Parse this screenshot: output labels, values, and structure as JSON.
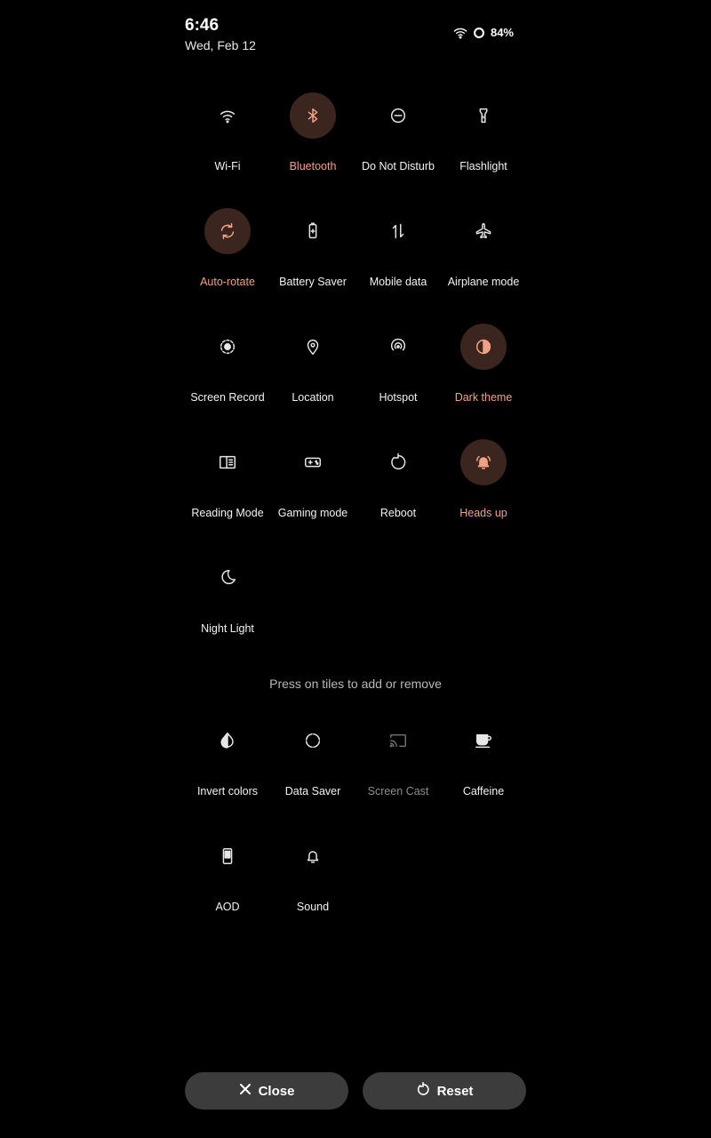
{
  "status_bar": {
    "time": "6:46",
    "date": "Wed, Feb 12",
    "battery": "84%"
  },
  "active_tiles": [
    {
      "label": "Wi-Fi",
      "icon": "wifi-icon",
      "active": false
    },
    {
      "label": "Bluetooth",
      "icon": "bluetooth-icon",
      "active": true
    },
    {
      "label": "Do Not Disturb",
      "icon": "do-not-disturb-icon",
      "active": false
    },
    {
      "label": "Flashlight",
      "icon": "flashlight-icon",
      "active": false
    },
    {
      "label": "Auto-rotate",
      "icon": "auto-rotate-icon",
      "active": true
    },
    {
      "label": "Battery Saver",
      "icon": "battery-saver-icon",
      "active": false
    },
    {
      "label": "Mobile data",
      "icon": "mobile-data-icon",
      "active": false
    },
    {
      "label": "Airplane mode",
      "icon": "airplane-icon",
      "active": false
    },
    {
      "label": "Screen Record",
      "icon": "screen-record-icon",
      "active": false
    },
    {
      "label": "Location",
      "icon": "location-icon",
      "active": false
    },
    {
      "label": "Hotspot",
      "icon": "hotspot-icon",
      "active": false
    },
    {
      "label": "Dark theme",
      "icon": "dark-theme-icon",
      "active": true
    },
    {
      "label": "Reading Mode",
      "icon": "reading-mode-icon",
      "active": false
    },
    {
      "label": "Gaming mode",
      "icon": "gaming-mode-icon",
      "active": false
    },
    {
      "label": "Reboot",
      "icon": "reboot-icon",
      "active": false
    },
    {
      "label": "Heads up",
      "icon": "heads-up-icon",
      "active": true
    },
    {
      "label": "Night Light",
      "icon": "night-light-icon",
      "active": false
    }
  ],
  "hint": "Press on tiles to add or remove",
  "available_tiles": [
    {
      "label": "Invert colors",
      "icon": "invert-colors-icon",
      "dim": false
    },
    {
      "label": "Data Saver",
      "icon": "data-saver-icon",
      "dim": false
    },
    {
      "label": "Screen Cast",
      "icon": "screen-cast-icon",
      "dim": true
    },
    {
      "label": "Caffeine",
      "icon": "caffeine-icon",
      "dim": false
    },
    {
      "label": "AOD",
      "icon": "aod-icon",
      "dim": false
    },
    {
      "label": "Sound",
      "icon": "sound-icon",
      "dim": false
    }
  ],
  "buttons": {
    "close": "Close",
    "reset": "Reset"
  },
  "colors": {
    "accent": "#f2a184",
    "active_bg": "#3a251f",
    "button_bg": "#3c3c3c"
  }
}
